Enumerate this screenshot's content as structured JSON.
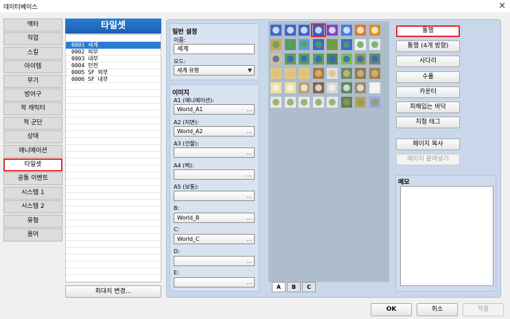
{
  "window": {
    "title": "데이터베이스",
    "close": "×"
  },
  "tabs": [
    {
      "label": "액터"
    },
    {
      "label": "직업"
    },
    {
      "label": "스킬"
    },
    {
      "label": "아이템"
    },
    {
      "label": "무기"
    },
    {
      "label": "방어구"
    },
    {
      "label": "적 캐릭터"
    },
    {
      "label": "적 군단"
    },
    {
      "label": "상태"
    },
    {
      "label": "애니메이션"
    },
    {
      "label": "타일셋"
    },
    {
      "label": "공통 이벤트"
    },
    {
      "label": "시스템 1"
    },
    {
      "label": "시스템 2"
    },
    {
      "label": "유형"
    },
    {
      "label": "용어"
    }
  ],
  "tileset_list": {
    "header": "타일셋",
    "items": [
      "0001 세계",
      "0002 외부",
      "0003 내부",
      "0004 던전",
      "0005 SF 외부",
      "0006 SF 내부"
    ],
    "selected_index": 0,
    "max_button": "최대치 변경..."
  },
  "general": {
    "title": "일반 설정",
    "name_label": "이름:",
    "name_value": "세계",
    "mode_label": "모드:",
    "mode_value": "세계 유형",
    "mode_arrow": "▼"
  },
  "images": {
    "title": "이미지",
    "fields": [
      {
        "label": "A1 (애니메이션):",
        "value": "World_A1"
      },
      {
        "label": "A2 (지면):",
        "value": "World_A2"
      },
      {
        "label": "A3 (건물):",
        "value": ""
      },
      {
        "label": "A4 (벽):",
        "value": ""
      },
      {
        "label": "A5 (보통):",
        "value": ""
      },
      {
        "label": "B:",
        "value": "World_B"
      },
      {
        "label": "C:",
        "value": "World_C"
      },
      {
        "label": "D:",
        "value": ""
      },
      {
        "label": "E:",
        "value": ""
      }
    ],
    "browse": "..."
  },
  "tile_tabs": [
    "A",
    "B",
    "C"
  ],
  "flags": {
    "items": [
      "통행",
      "통행 (4개 방향)",
      "사다리",
      "수풀",
      "카운터",
      "피해입는 바닥",
      "지형 태그"
    ],
    "selected": "통행"
  },
  "page_buttons": {
    "copy": "페이지 복사",
    "paste": "페이지 붙여넣기"
  },
  "memo": {
    "title": "메모"
  },
  "footer": {
    "ok": "OK",
    "cancel": "취소",
    "apply": "적용"
  },
  "colors": {
    "accent": "#2b7cd1",
    "highlight": "#e0232b",
    "panel": "#c9d7ea"
  }
}
